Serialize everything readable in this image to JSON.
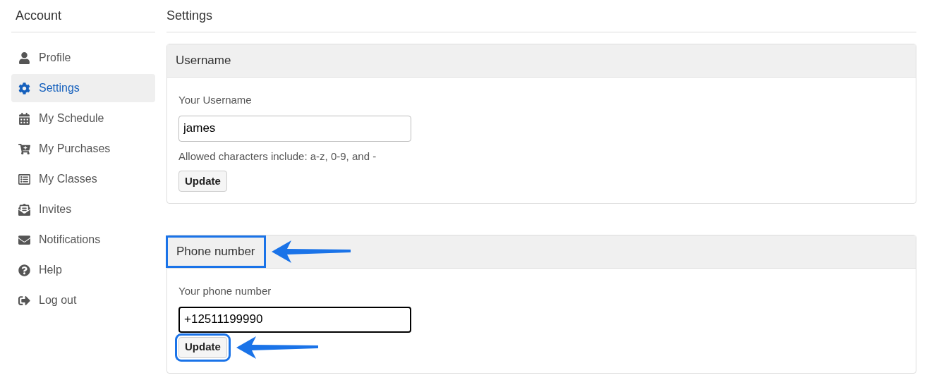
{
  "sidebar": {
    "title": "Account",
    "items": [
      {
        "label": "Profile",
        "selected": false
      },
      {
        "label": "Settings",
        "selected": true
      },
      {
        "label": "My Schedule",
        "selected": false
      },
      {
        "label": "My Purchases",
        "selected": false
      },
      {
        "label": "My Classes",
        "selected": false
      },
      {
        "label": "Invites",
        "selected": false
      },
      {
        "label": "Notifications",
        "selected": false
      },
      {
        "label": "Help",
        "selected": false
      },
      {
        "label": "Log out",
        "selected": false
      }
    ]
  },
  "main": {
    "title": "Settings",
    "panels": [
      {
        "title": "Username",
        "title_highlighted": false,
        "label": "Your Username",
        "value": "james",
        "focused": false,
        "help": "Allowed characters include: a-z, 0-9, and -",
        "button": "Update",
        "button_highlighted": false
      },
      {
        "title": "Phone number",
        "title_highlighted": true,
        "label": "Your phone number",
        "value": "+12511199990",
        "focused": true,
        "button": "Update",
        "button_highlighted": true
      }
    ]
  }
}
